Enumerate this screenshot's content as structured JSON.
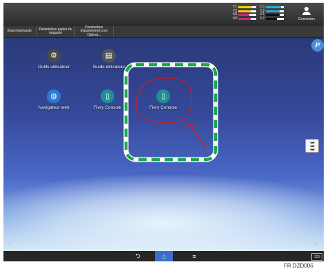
{
  "topbar": {
    "toner": [
      {
        "label": "Y1",
        "color": "#f5d000"
      },
      {
        "label": "C1",
        "color": "#2aa8e0"
      },
      {
        "label": "Y2",
        "color": "#f5d000"
      },
      {
        "label": "C2",
        "color": "#2aa8e0"
      },
      {
        "label": "M1",
        "color": "#d0228a"
      },
      {
        "label": "K1",
        "color": "#111111"
      },
      {
        "label": "M2",
        "color": "#d0228a"
      },
      {
        "label": "K2",
        "color": "#111111"
      }
    ],
    "login_label": "Connexion"
  },
  "tabs": [
    {
      "label": "État imprimante"
    },
    {
      "label": "Paramètres papier du magasin"
    },
    {
      "label": "Paramètres d'ajustement pour Opérat..."
    }
  ],
  "apps": [
    {
      "label": "Outils utilisateur",
      "icon": "gear-icon"
    },
    {
      "label": "Guide utilisateur",
      "icon": "book-icon"
    },
    {
      "label": "Navigateur web",
      "icon": "globe-icon"
    },
    {
      "label": "Fiery Console",
      "icon": "fiery-icon"
    },
    {
      "label": "Fiery Console",
      "icon": "fiery-icon"
    }
  ],
  "bottom": {
    "back_icon": "back-arrow-icon",
    "home_icon": "home-icon",
    "menu_icon": "menu-icon",
    "keyboard_label": "123"
  },
  "colors": {
    "accent": "#3d6ecc",
    "highlight_dash": "#1aa84a",
    "annotation_red": "#e0161b"
  },
  "caption": "FR DZD006"
}
